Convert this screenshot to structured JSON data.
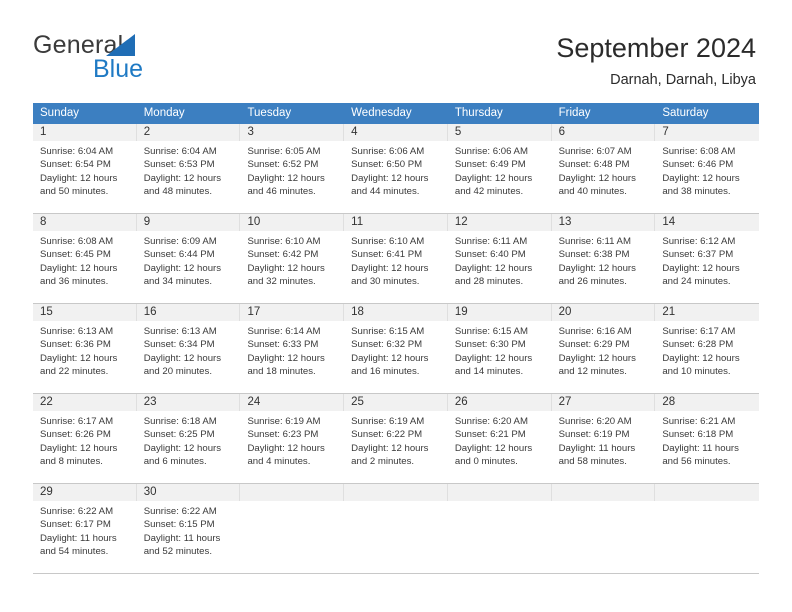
{
  "brand": {
    "name_part1": "General",
    "name_part2": "Blue",
    "triangle_icon": "triangle-icon",
    "accent_color": "#1f7ac4"
  },
  "header": {
    "title": "September 2024",
    "subtitle": "Darnah, Darnah, Libya"
  },
  "theme": {
    "header_bg": "#3c7fc1",
    "daynum_bg": "#f1f1f1",
    "grid_line": "#c8c8c8",
    "text": "#3a3a3a"
  },
  "weekdays": [
    "Sunday",
    "Monday",
    "Tuesday",
    "Wednesday",
    "Thursday",
    "Friday",
    "Saturday"
  ],
  "weeks": [
    [
      {
        "day": "1",
        "sunrise": "Sunrise: 6:04 AM",
        "sunset": "Sunset: 6:54 PM",
        "daylight1": "Daylight: 12 hours",
        "daylight2": "and 50 minutes."
      },
      {
        "day": "2",
        "sunrise": "Sunrise: 6:04 AM",
        "sunset": "Sunset: 6:53 PM",
        "daylight1": "Daylight: 12 hours",
        "daylight2": "and 48 minutes."
      },
      {
        "day": "3",
        "sunrise": "Sunrise: 6:05 AM",
        "sunset": "Sunset: 6:52 PM",
        "daylight1": "Daylight: 12 hours",
        "daylight2": "and 46 minutes."
      },
      {
        "day": "4",
        "sunrise": "Sunrise: 6:06 AM",
        "sunset": "Sunset: 6:50 PM",
        "daylight1": "Daylight: 12 hours",
        "daylight2": "and 44 minutes."
      },
      {
        "day": "5",
        "sunrise": "Sunrise: 6:06 AM",
        "sunset": "Sunset: 6:49 PM",
        "daylight1": "Daylight: 12 hours",
        "daylight2": "and 42 minutes."
      },
      {
        "day": "6",
        "sunrise": "Sunrise: 6:07 AM",
        "sunset": "Sunset: 6:48 PM",
        "daylight1": "Daylight: 12 hours",
        "daylight2": "and 40 minutes."
      },
      {
        "day": "7",
        "sunrise": "Sunrise: 6:08 AM",
        "sunset": "Sunset: 6:46 PM",
        "daylight1": "Daylight: 12 hours",
        "daylight2": "and 38 minutes."
      }
    ],
    [
      {
        "day": "8",
        "sunrise": "Sunrise: 6:08 AM",
        "sunset": "Sunset: 6:45 PM",
        "daylight1": "Daylight: 12 hours",
        "daylight2": "and 36 minutes."
      },
      {
        "day": "9",
        "sunrise": "Sunrise: 6:09 AM",
        "sunset": "Sunset: 6:44 PM",
        "daylight1": "Daylight: 12 hours",
        "daylight2": "and 34 minutes."
      },
      {
        "day": "10",
        "sunrise": "Sunrise: 6:10 AM",
        "sunset": "Sunset: 6:42 PM",
        "daylight1": "Daylight: 12 hours",
        "daylight2": "and 32 minutes."
      },
      {
        "day": "11",
        "sunrise": "Sunrise: 6:10 AM",
        "sunset": "Sunset: 6:41 PM",
        "daylight1": "Daylight: 12 hours",
        "daylight2": "and 30 minutes."
      },
      {
        "day": "12",
        "sunrise": "Sunrise: 6:11 AM",
        "sunset": "Sunset: 6:40 PM",
        "daylight1": "Daylight: 12 hours",
        "daylight2": "and 28 minutes."
      },
      {
        "day": "13",
        "sunrise": "Sunrise: 6:11 AM",
        "sunset": "Sunset: 6:38 PM",
        "daylight1": "Daylight: 12 hours",
        "daylight2": "and 26 minutes."
      },
      {
        "day": "14",
        "sunrise": "Sunrise: 6:12 AM",
        "sunset": "Sunset: 6:37 PM",
        "daylight1": "Daylight: 12 hours",
        "daylight2": "and 24 minutes."
      }
    ],
    [
      {
        "day": "15",
        "sunrise": "Sunrise: 6:13 AM",
        "sunset": "Sunset: 6:36 PM",
        "daylight1": "Daylight: 12 hours",
        "daylight2": "and 22 minutes."
      },
      {
        "day": "16",
        "sunrise": "Sunrise: 6:13 AM",
        "sunset": "Sunset: 6:34 PM",
        "daylight1": "Daylight: 12 hours",
        "daylight2": "and 20 minutes."
      },
      {
        "day": "17",
        "sunrise": "Sunrise: 6:14 AM",
        "sunset": "Sunset: 6:33 PM",
        "daylight1": "Daylight: 12 hours",
        "daylight2": "and 18 minutes."
      },
      {
        "day": "18",
        "sunrise": "Sunrise: 6:15 AM",
        "sunset": "Sunset: 6:32 PM",
        "daylight1": "Daylight: 12 hours",
        "daylight2": "and 16 minutes."
      },
      {
        "day": "19",
        "sunrise": "Sunrise: 6:15 AM",
        "sunset": "Sunset: 6:30 PM",
        "daylight1": "Daylight: 12 hours",
        "daylight2": "and 14 minutes."
      },
      {
        "day": "20",
        "sunrise": "Sunrise: 6:16 AM",
        "sunset": "Sunset: 6:29 PM",
        "daylight1": "Daylight: 12 hours",
        "daylight2": "and 12 minutes."
      },
      {
        "day": "21",
        "sunrise": "Sunrise: 6:17 AM",
        "sunset": "Sunset: 6:28 PM",
        "daylight1": "Daylight: 12 hours",
        "daylight2": "and 10 minutes."
      }
    ],
    [
      {
        "day": "22",
        "sunrise": "Sunrise: 6:17 AM",
        "sunset": "Sunset: 6:26 PM",
        "daylight1": "Daylight: 12 hours",
        "daylight2": "and 8 minutes."
      },
      {
        "day": "23",
        "sunrise": "Sunrise: 6:18 AM",
        "sunset": "Sunset: 6:25 PM",
        "daylight1": "Daylight: 12 hours",
        "daylight2": "and 6 minutes."
      },
      {
        "day": "24",
        "sunrise": "Sunrise: 6:19 AM",
        "sunset": "Sunset: 6:23 PM",
        "daylight1": "Daylight: 12 hours",
        "daylight2": "and 4 minutes."
      },
      {
        "day": "25",
        "sunrise": "Sunrise: 6:19 AM",
        "sunset": "Sunset: 6:22 PM",
        "daylight1": "Daylight: 12 hours",
        "daylight2": "and 2 minutes."
      },
      {
        "day": "26",
        "sunrise": "Sunrise: 6:20 AM",
        "sunset": "Sunset: 6:21 PM",
        "daylight1": "Daylight: 12 hours",
        "daylight2": "and 0 minutes."
      },
      {
        "day": "27",
        "sunrise": "Sunrise: 6:20 AM",
        "sunset": "Sunset: 6:19 PM",
        "daylight1": "Daylight: 11 hours",
        "daylight2": "and 58 minutes."
      },
      {
        "day": "28",
        "sunrise": "Sunrise: 6:21 AM",
        "sunset": "Sunset: 6:18 PM",
        "daylight1": "Daylight: 11 hours",
        "daylight2": "and 56 minutes."
      }
    ],
    [
      {
        "day": "29",
        "sunrise": "Sunrise: 6:22 AM",
        "sunset": "Sunset: 6:17 PM",
        "daylight1": "Daylight: 11 hours",
        "daylight2": "and 54 minutes."
      },
      {
        "day": "30",
        "sunrise": "Sunrise: 6:22 AM",
        "sunset": "Sunset: 6:15 PM",
        "daylight1": "Daylight: 11 hours",
        "daylight2": "and 52 minutes."
      },
      {
        "day": "",
        "sunrise": "",
        "sunset": "",
        "daylight1": "",
        "daylight2": ""
      },
      {
        "day": "",
        "sunrise": "",
        "sunset": "",
        "daylight1": "",
        "daylight2": ""
      },
      {
        "day": "",
        "sunrise": "",
        "sunset": "",
        "daylight1": "",
        "daylight2": ""
      },
      {
        "day": "",
        "sunrise": "",
        "sunset": "",
        "daylight1": "",
        "daylight2": ""
      },
      {
        "day": "",
        "sunrise": "",
        "sunset": "",
        "daylight1": "",
        "daylight2": ""
      }
    ]
  ]
}
